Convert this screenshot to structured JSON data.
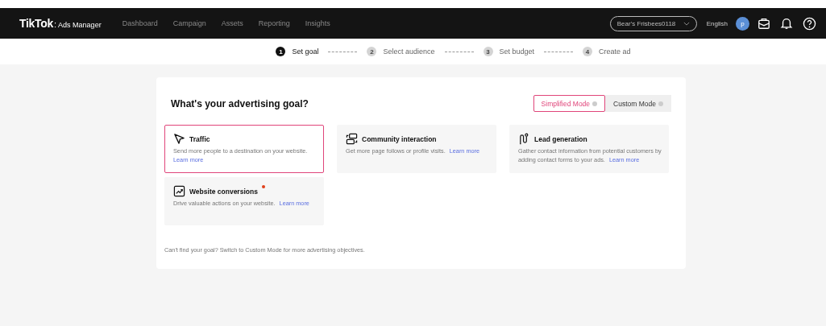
{
  "header": {
    "logo": "TikTok",
    "separator": ":",
    "product": "Ads Manager",
    "nav": [
      {
        "label": "Dashboard",
        "selected": false
      },
      {
        "label": "Campaign",
        "selected": false
      },
      {
        "label": "Assets",
        "selected": false
      },
      {
        "label": "Reporting",
        "selected": false
      },
      {
        "label": "Insights",
        "selected": false
      }
    ],
    "account": "Bear's Frisbees0118",
    "language": "English",
    "avatar": "p"
  },
  "steps": [
    {
      "number": "1",
      "label": "Set goal",
      "selected": true
    },
    {
      "number": "2",
      "label": "Select audience",
      "selected": false
    },
    {
      "number": "3",
      "label": "Set budget",
      "selected": false
    },
    {
      "number": "4",
      "label": "Create ad",
      "selected": false
    }
  ],
  "goal_panel": {
    "title": "What's your advertising goal?",
    "modes": [
      {
        "label": "Simplified Mode",
        "selected": true
      },
      {
        "label": "Custom Mode",
        "selected": false
      }
    ],
    "goals": [
      {
        "kind": "traffic",
        "title": "Traffic",
        "description": "Send more people to a destination on your website.",
        "link": "Learn more",
        "link_break": true,
        "selected": true,
        "new": false
      },
      {
        "kind": "community",
        "title": "Community interaction",
        "description": "Get more page follows or profile visits.",
        "link": "Learn more",
        "link_break": false,
        "selected": false,
        "new": false
      },
      {
        "kind": "lead",
        "title": "Lead generation",
        "description": "Gather contact information from potential customers by adding contact forms to your ads.",
        "link": "Learn more",
        "link_break": false,
        "selected": false,
        "new": false
      },
      {
        "kind": "conversions",
        "title": "Website conversions",
        "description": "Drive valuable actions on your website.",
        "link": "Learn more",
        "link_break": false,
        "selected": false,
        "new": true
      }
    ],
    "footer_note": "Can't find your goal? Switch to Custom Mode for more advertising objectives."
  }
}
